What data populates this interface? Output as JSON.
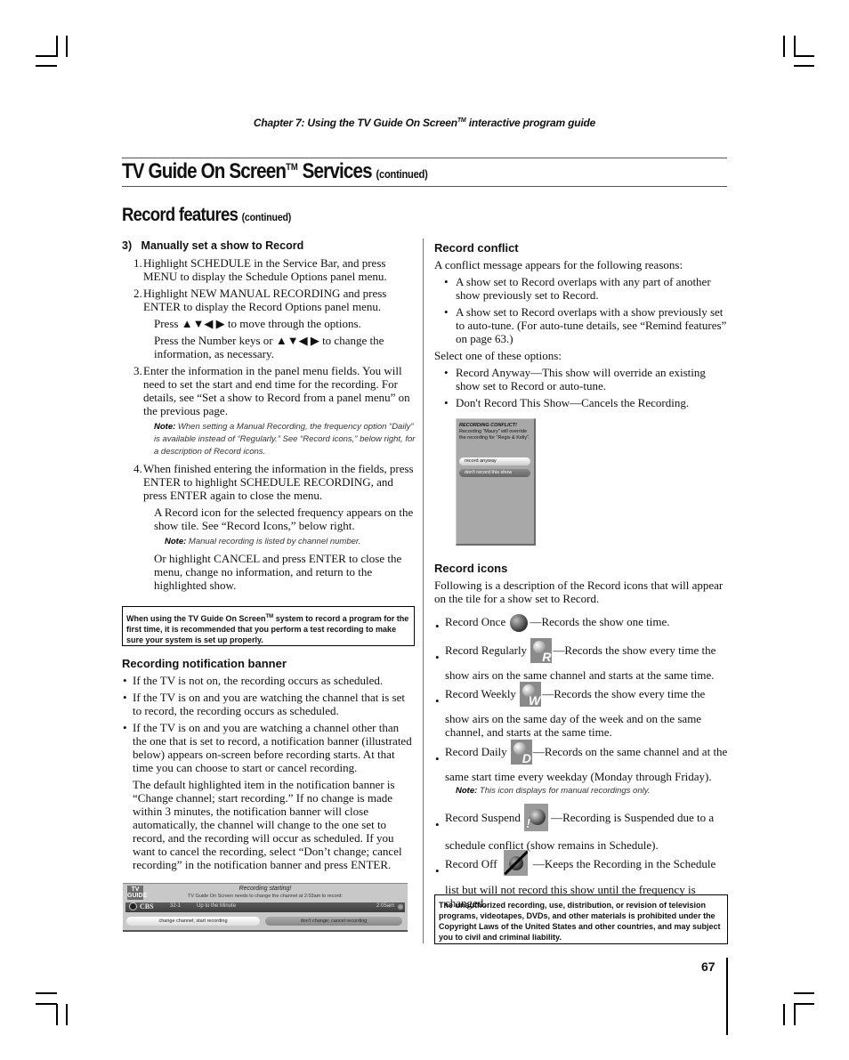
{
  "header": {
    "chapter": "Chapter 7: Using the TV Guide On Screen",
    "chapter_tm": "TM",
    "chapter_suffix": " interactive program guide"
  },
  "title": {
    "main": "TV Guide On Screen",
    "tm": "TM",
    "main_suffix": " Services ",
    "continued": "(continued)"
  },
  "section": {
    "title": "Record features ",
    "continued": "(continued)"
  },
  "left": {
    "manual_heading": "3)   Manually set a show to Record",
    "steps": [
      {
        "n": "1.",
        "text": "Highlight SCHEDULE in the Service Bar, and press MENU to display the Schedule Options panel menu."
      },
      {
        "n": "2.",
        "text": "Highlight NEW MANUAL RECORDING and press ENTER to display the Record Options panel menu."
      }
    ],
    "press_arrows_1": "Press ▲▼◀ ▶ to move through the options.",
    "press_arrows_2": "Press the Number keys or ▲▼◀ ▶ to change the information, as necessary.",
    "step3": {
      "n": "3.",
      "text": "Enter the information in the panel menu fields. You will need to set the start and end time for the recording. For details, see “Set a show to Record from a panel menu” on the previous page."
    },
    "note1_label": "Note:",
    "note1_text": " When setting a Manual Recording, the frequency option “Daily” is available instead of “Regularly.” See “Record icons,” below right, for a description of Record icons.",
    "step4": {
      "n": "4.",
      "text": "When finished entering the information in the fields, press ENTER to highlight SCHEDULE RECORDING, and press ENTER again to close the menu."
    },
    "record_icon_text": "A Record icon for the selected frequency appears on the show tile. See “Record Icons,” below right.",
    "note2_label": "Note:",
    "note2_text": " Manual recording is listed by channel number.",
    "cancel_text": "Or highlight CANCEL and press ENTER to close the menu, change no information, and return to the highlighted show.",
    "tip_box": {
      "pre": "When using the TV Guide On Screen",
      "tm": "TM",
      "post": " system to record a program for the first time, it is recommended that you perform a test recording to make sure your system is set up properly."
    },
    "banner_heading": "Recording notification banner",
    "banner_bullets": [
      "If the TV is not on, the recording occurs as scheduled.",
      "If the TV is on and you are watching the channel that is set to record, the recording occurs as scheduled.",
      "If the TV is on and you are watching a channel other than the one that is set to record, a notification banner (illustrated below) appears on-screen before recording starts. At that time you can choose to start or cancel recording."
    ],
    "banner_para": "The default highlighted item in the notification banner is “Change channel; start recording.” If no change is made within 3 minutes, the notification banner will close automatically, the channel will change to the one set to record, and the recording will occur as scheduled. If you want to cancel the recording, select “Don’t change; cancel recording” in the notification banner and press ENTER."
  },
  "banner_screen": {
    "logo": "TV GUIDE",
    "title": "Recording starting!",
    "message": "TV Guide On Screen needs to change the channel at   2:03am to record:",
    "network": "CBS",
    "channel": "32-1",
    "show": "Up to the Minute",
    "time": "2:05am",
    "button_start": "change channel; start recording",
    "button_cancel": "don't change; cancel recording"
  },
  "right": {
    "conflict_heading": "Record conflict",
    "conflict_intro": "A conflict message appears for the following reasons:",
    "conflict_reasons": [
      "A show set to Record overlaps with any part of another show previously set to Record.",
      "A show set to Record overlaps with a show previously set to auto-tune. (For auto-tune details, see “Remind features” on page 63.)"
    ],
    "select_intro": "Select one of these options:",
    "options": [
      "Record Anyway—This show will override an existing show set to Record or auto-tune.",
      "Don't Record This Show—Cancels the Recording."
    ],
    "icons_heading": "Record icons",
    "icons_intro": "Following is a description of the Record icons that will appear on the tile for a show set to Record.",
    "icons": [
      {
        "name": "Record Once",
        "desc": "—Records the show one time.",
        "icon": "record-once"
      },
      {
        "name": "Record Regularly",
        "desc": "—Records the show every time the show airs on the same channel and starts at the same time.",
        "icon": "record-regularly",
        "letter": "R"
      },
      {
        "name": "Record Weekly",
        "desc": "—Records the show every time the show airs on the same day of the week and on the same channel, and starts at the same time.",
        "icon": "record-weekly",
        "letter": "W"
      },
      {
        "name": "Record Daily",
        "desc": "—Records on the same channel and at the same start time every weekday (Monday through Friday).",
        "icon": "record-daily",
        "letter": "D"
      },
      {
        "name": "Record Suspend",
        "desc": "—Recording is Suspended due to a schedule conflict (show remains in Schedule).",
        "icon": "record-suspend",
        "letter": "!"
      },
      {
        "name": "Record Off",
        "desc": "—Keeps the Recording in the Schedule list but will not record this show until the frequency is changed.",
        "icon": "record-off"
      }
    ],
    "daily_note_label": "Note:",
    "daily_note_text": " This icon displays for manual recordings only.",
    "copyright_box": "The unauthorized recording, use, distribution, or revision of television programs, videotapes, DVDs, and other materials is prohibited under the Copyright Laws of the United States and other countries, and may subject you to civil and criminal liability."
  },
  "conflict_screen": {
    "title": "RECORDING CONFLICT!",
    "message": "Recording “Maury” will override the recording for “Regis & Kelly”.",
    "button_anyway": "record anyway",
    "button_dont": "don't record this show"
  },
  "page_number": "67"
}
